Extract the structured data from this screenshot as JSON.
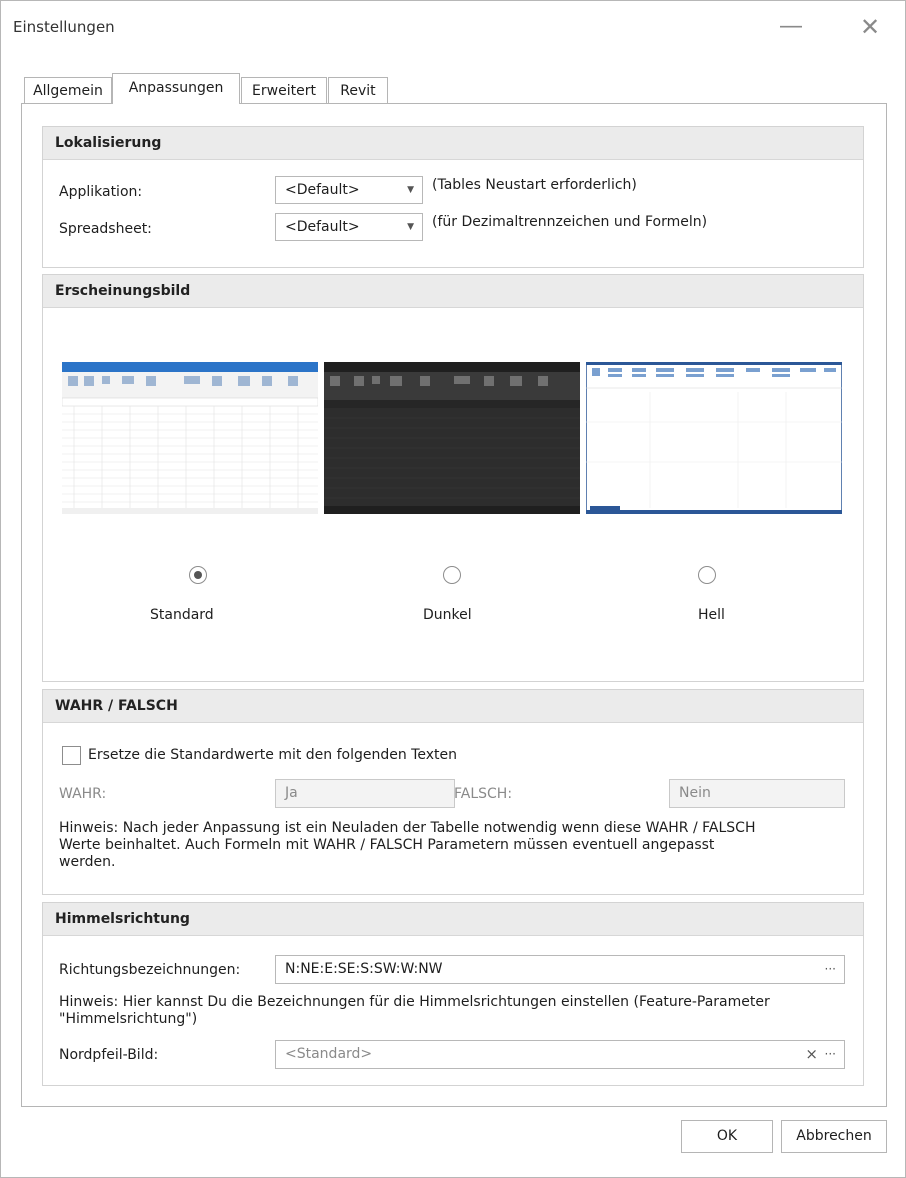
{
  "window": {
    "title": "Einstellungen"
  },
  "tabs": [
    {
      "label": "Allgemein"
    },
    {
      "label": "Anpassungen"
    },
    {
      "label": "Erweitert"
    },
    {
      "label": "Revit"
    }
  ],
  "localization": {
    "header": "Lokalisierung",
    "app_label": "Applikation:",
    "app_value": "<Default>",
    "app_hint": "(Tables Neustart erforderlich)",
    "sheet_label": "Spreadsheet:",
    "sheet_value": "<Default>",
    "sheet_hint": "(für Dezimaltrennzeichen und Formeln)"
  },
  "appearance": {
    "header": "Erscheinungsbild",
    "themes": [
      {
        "label": "Standard",
        "selected": true
      },
      {
        "label": "Dunkel",
        "selected": false
      },
      {
        "label": "Hell",
        "selected": false
      }
    ]
  },
  "bool": {
    "header": "WAHR / FALSCH",
    "checkbox_label": "Ersetze die Standardwerte mit den folgenden Texten",
    "checked": false,
    "true_label": "WAHR:",
    "true_value": "Ja",
    "false_label": "FALSCH:",
    "false_value": "Nein",
    "note_line1": "Hinweis: Nach jeder Anpassung ist ein Neuladen der Tabelle notwendig wenn diese WAHR / FALSCH",
    "note_line2": "Werte beinhaltet. Auch Formeln mit WAHR / FALSCH Parametern müssen eventuell angepasst",
    "note_line3": "werden."
  },
  "direction": {
    "header": "Himmelsrichtung",
    "names_label": "Richtungsbezeichnungen:",
    "names_value": "N:NE:E:SE:S:SW:W:NW",
    "note_line1": "Hinweis: Hier kannst Du die Bezeichnungen für die Himmelsrichtungen einstellen (Feature-Parameter",
    "note_line2": "\"Himmelsrichtung\")",
    "image_label": "Nordpfeil-Bild:",
    "image_value": "<Standard>"
  },
  "buttons": {
    "ok": "OK",
    "cancel": "Abbrechen"
  },
  "icons": {
    "minimize": "―",
    "close": "✕",
    "dropdown": "▼",
    "ellipsis": "···",
    "clear": "×"
  },
  "colors": {
    "header_bg": "#ebebeb",
    "accent_blue": "#2b5797",
    "dark_theme": "#2b2b2b"
  }
}
